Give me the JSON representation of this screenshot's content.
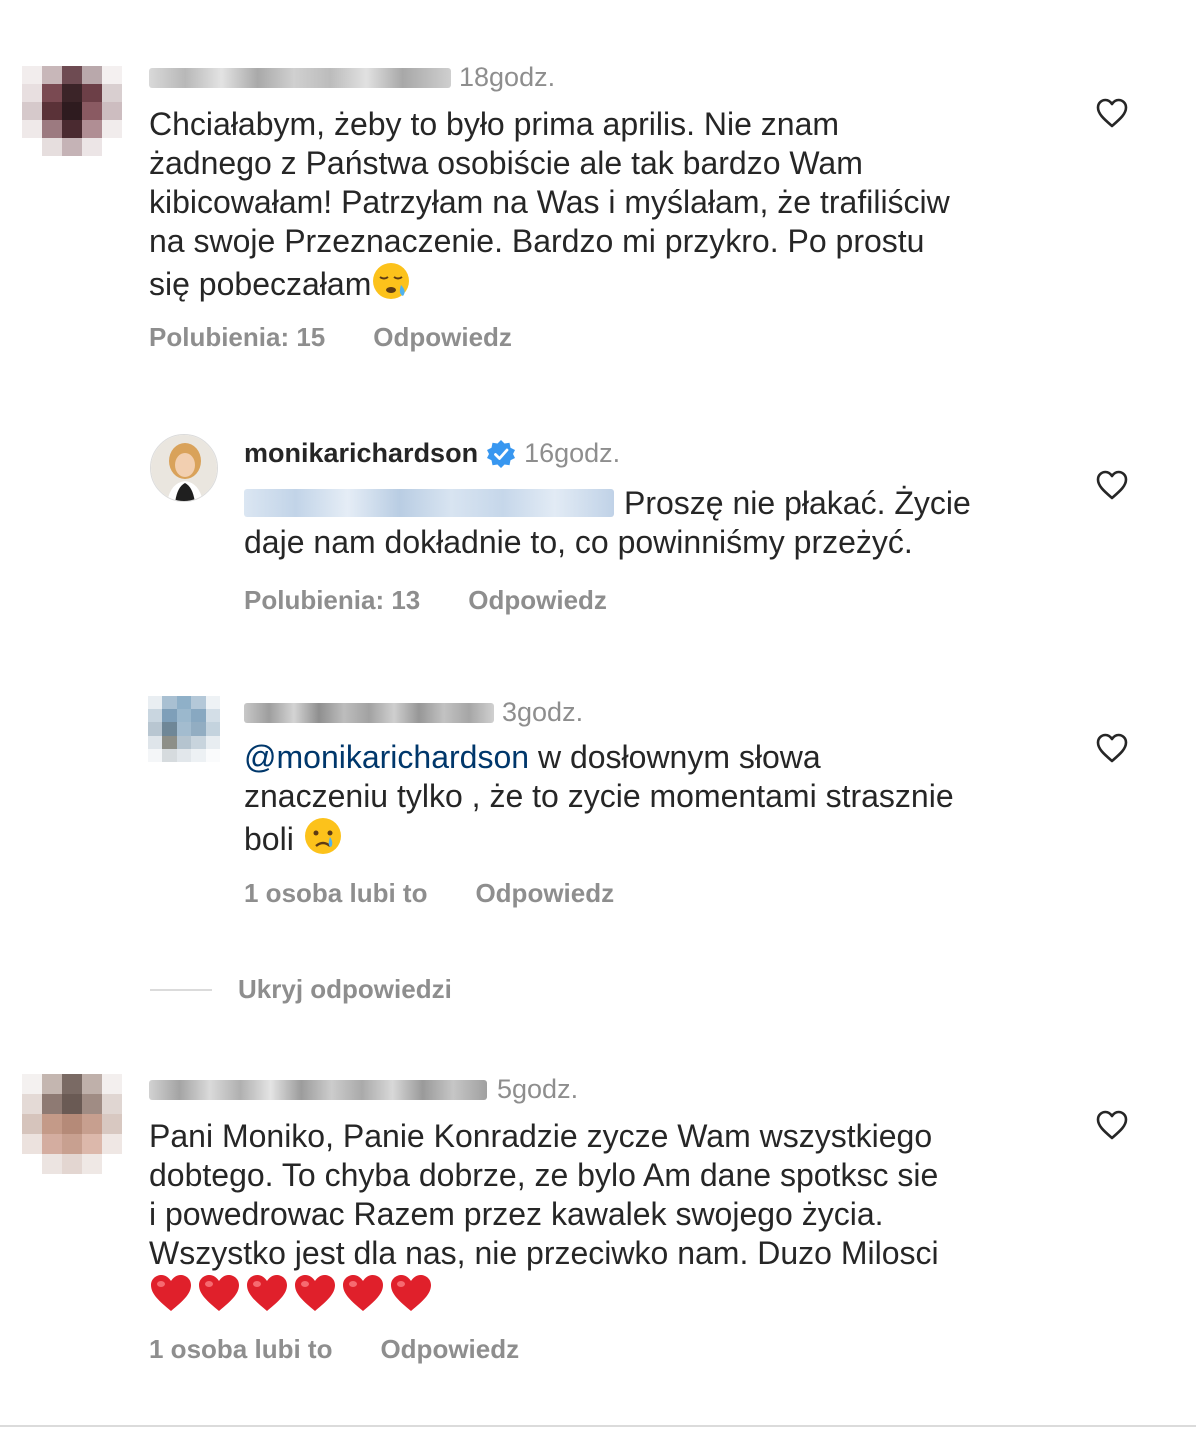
{
  "comments": [
    {
      "time": "18godz.",
      "text": "Chciałabym, żeby to było prima aprilis. Nie znam\nżadnego z Państwa osobiście ale tak bardzo Wam\nkibicowałam! Patrzyłam na Was i myślałam, że trafiliściw\nna swoje Przeznaczenie. Bardzo mi przykro. Po prostu\nsię pobeczałam",
      "likes": "Polubienia: 15",
      "reply": "Odpowiedz"
    },
    {
      "username": "monikarichardson",
      "time": "16godz.",
      "text_line1": "Proszę nie płakać. Życie",
      "text_line2": "daje nam dokładnie to, co powinniśmy przeżyć.",
      "likes": "Polubienia: 13",
      "reply": "Odpowiedz"
    },
    {
      "time": "3godz.",
      "mention": "@monikarichardson",
      "text_line1": " w dosłownym słowa",
      "text_rest": "znaczeniu tylko , że to zycie momentami strasznie\nboli",
      "likes": "1 osoba lubi to",
      "reply": "Odpowiedz"
    },
    {
      "time": "5godz.",
      "text": "Pani Moniko, Panie Konradzie zycze Wam wszystkiego\ndobtego. To chyba dobrze, ze bylo Am dane spotksc sie\ni powedrowac Razem przez kawalek swojego życia.\nWszystko jest dla nas, nie przeciwko nam. Duzo Milosci",
      "likes": "1 osoba lubi to",
      "reply": "Odpowiedz"
    }
  ],
  "hide_replies": "Ukryj odpowiedzi",
  "colors": {
    "text": "#262626",
    "secondary": "#8e8e8e",
    "mention": "#00376b",
    "verified": "#3897f0",
    "heart_red": "#e0202b"
  },
  "icons": [
    "heart-outline-icon",
    "verified-badge-icon",
    "sleepy-face-emoji",
    "crying-face-emoji",
    "red-heart-emoji"
  ]
}
